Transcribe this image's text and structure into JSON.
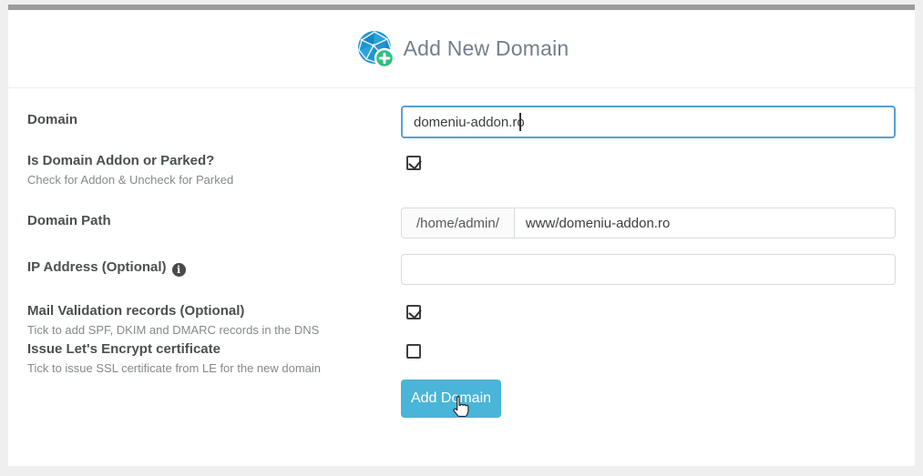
{
  "header": {
    "title": "Add New Domain",
    "icon": "globe-with-plus"
  },
  "form": {
    "domain": {
      "label": "Domain",
      "value": "domeniu-addon.ro",
      "focused": true
    },
    "addon_parked": {
      "label": "Is Domain Addon or Parked?",
      "helper": "Check for Addon & Uncheck for Parked",
      "checked": true
    },
    "domain_path": {
      "label": "Domain Path",
      "prefix": "/home/admin/",
      "value": "www/domeniu-addon.ro"
    },
    "ip_address": {
      "label": "IP Address (Optional)",
      "info_icon": "i",
      "value": ""
    },
    "mail_validation": {
      "label": "Mail Validation records (Optional)",
      "helper": "Tick to add SPF, DKIM and DMARC records in the DNS",
      "checked": true
    },
    "lets_encrypt": {
      "label": "Issue Let's Encrypt certificate",
      "helper": "Tick to issue SSL certificate from LE for the new domain",
      "checked": false
    },
    "submit_label": "Add Domain"
  },
  "colors": {
    "page_background": "#efefef",
    "panel_background": "#ffffff",
    "panel_top_accent": "#9c9c9c",
    "title_text": "#72808b",
    "label_text": "#4b4f52",
    "helper_text": "#85898c",
    "input_border": "#d8dcde",
    "focused_input_border": "#539fd6",
    "button_background": "#4ab5d8",
    "button_text": "#ffffff",
    "globe_blue": "#2095d4",
    "badge_green": "#2fbe80"
  }
}
